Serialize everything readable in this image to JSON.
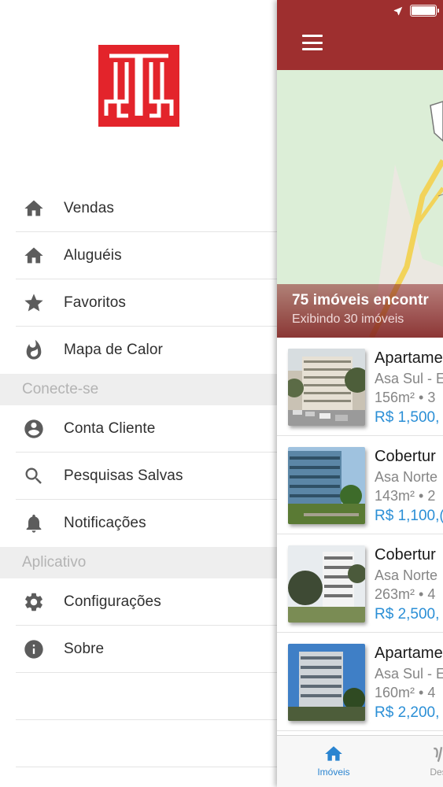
{
  "colors": {
    "brand_red": "#9e2f2f",
    "logo_red": "#e3242b",
    "price_blue": "#2b8fd6",
    "tab_active_blue": "#2a84d0"
  },
  "drawer": {
    "logo_icon": "building-logo",
    "items": [
      {
        "label": "Vendas",
        "icon": "home-icon"
      },
      {
        "label": "Aluguéis",
        "icon": "home-icon"
      },
      {
        "label": "Favoritos",
        "icon": "star-icon"
      },
      {
        "label": "Mapa de Calor",
        "icon": "flame-icon"
      }
    ],
    "section_connect": "Conecte-se",
    "connect_items": [
      {
        "label": "Conta Cliente",
        "icon": "account-circle-icon"
      },
      {
        "label": "Pesquisas Salvas",
        "icon": "search-icon"
      },
      {
        "label": "Notificações",
        "icon": "bell-icon"
      }
    ],
    "section_app": "Aplicativo",
    "app_items": [
      {
        "label": "Configurações",
        "icon": "gear-icon"
      },
      {
        "label": "Sobre",
        "icon": "info-icon"
      }
    ]
  },
  "main": {
    "menu_icon": "hamburger-icon",
    "results_title": "75 imóveis encontr",
    "results_subtitle": "Exibindo 30 imóveis",
    "listings": [
      {
        "title": "Apartame",
        "location": "Asa Sul - E",
        "size": "156m² • 3",
        "price": "R$ 1,500,"
      },
      {
        "title": "Cobertur",
        "location": "Asa Norte",
        "size": "143m² • 2",
        "price": "R$ 1,100,("
      },
      {
        "title": "Cobertur",
        "location": "Asa Norte",
        "size": "263m² • 4",
        "price": "R$ 2,500,"
      },
      {
        "title": "Apartame",
        "location": "Asa Sul - E",
        "size": "160m² • 4",
        "price": "R$ 2,200,"
      }
    ],
    "tabs": [
      {
        "label": "Imóveis",
        "icon": "home-icon",
        "active": true
      },
      {
        "label": "Desc",
        "icon": "tab-2-icon",
        "active": false
      }
    ]
  }
}
